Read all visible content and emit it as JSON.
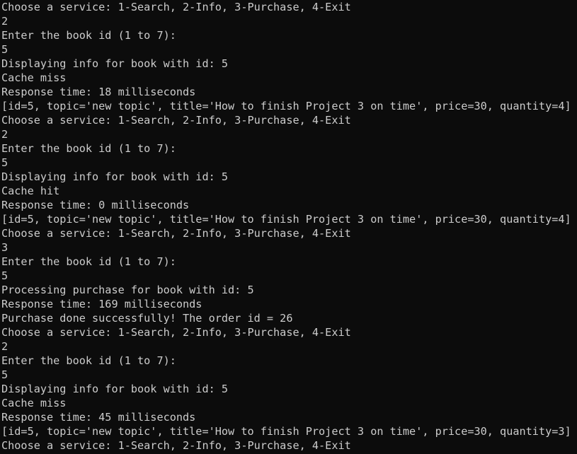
{
  "colors": {
    "background": "#0c0c0c",
    "text": "#cccccc"
  },
  "terminal": {
    "lines": [
      "Choose a service: 1-Search, 2-Info, 3-Purchase, 4-Exit",
      "2",
      "Enter the book id (1 to 7):",
      "5",
      "Displaying info for book with id: 5",
      "Cache miss",
      "Response time: 18 milliseconds",
      "[id=5, topic='new topic', title='How to finish Project 3 on time', price=30, quantity=4]",
      "Choose a service: 1-Search, 2-Info, 3-Purchase, 4-Exit",
      "2",
      "Enter the book id (1 to 7):",
      "5",
      "Displaying info for book with id: 5",
      "Cache hit",
      "Response time: 0 milliseconds",
      "[id=5, topic='new topic', title='How to finish Project 3 on time', price=30, quantity=4]",
      "Choose a service: 1-Search, 2-Info, 3-Purchase, 4-Exit",
      "3",
      "Enter the book id (1 to 7):",
      "5",
      "Processing purchase for book with id: 5",
      "Response time: 169 milliseconds",
      "Purchase done successfully! The order id = 26",
      "Choose a service: 1-Search, 2-Info, 3-Purchase, 4-Exit",
      "2",
      "Enter the book id (1 to 7):",
      "5",
      "Displaying info for book with id: 5",
      "Cache miss",
      "Response time: 45 milliseconds",
      "[id=5, topic='new topic', title='How to finish Project 3 on time', price=30, quantity=3]",
      "Choose a service: 1-Search, 2-Info, 3-Purchase, 4-Exit"
    ]
  }
}
